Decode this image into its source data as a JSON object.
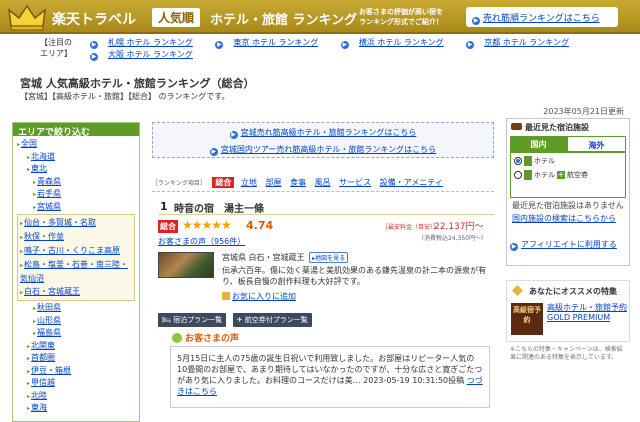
{
  "banner": {
    "title_part1": "楽天トラベル",
    "title_pill": "人気順",
    "title_part2": "ホテル・旅館 ランキング",
    "sub_line1": "お客さまの評価が高い宿を",
    "sub_line2": "ランキング形式でご紹介！",
    "sales_link": "売れ筋順ランキングはこちら"
  },
  "areas": {
    "label": "【注目のエリア】",
    "links": [
      "札幌 ホテル ランキング",
      "東京 ホテル ランキング",
      "横浜 ホテル ランキング",
      "京都 ホテル ランキング",
      "大阪 ホテル ランキング"
    ]
  },
  "page": {
    "title": "宮城 人気高級ホテル・旅館ランキング（総合）",
    "desc": "【宮城】【高級ホテル・旅館】【総合】 のランキングです。",
    "date": "2023年05月21日更新"
  },
  "sidebar": {
    "heading": "エリアで絞り込む",
    "items": [
      "全国",
      "北海道",
      "東北",
      "青森県",
      "岩手県",
      "宮城県"
    ],
    "miyagi_sub": [
      "仙台・多賀城・名取",
      "秋保・作並",
      "鳴子・古川・くりこま高原",
      "松島・塩釜・石巻・南三陸・気仙沼",
      "白石・宮城蔵王"
    ],
    "after": [
      "秋田県",
      "山形県",
      "福島県",
      "北関東",
      "首都圏",
      "伊豆・箱根",
      "甲信越",
      "北陸",
      "東海"
    ]
  },
  "notice": {
    "line1": "宮城売れ筋高級ホテル・旅館ランキングはこちら",
    "line2": "宮城国内ツアー売れ筋高級ホテル・旅館ランキングはこちら"
  },
  "tabs": {
    "label": "［ランキング項目］",
    "selected": "総合",
    "items": [
      "立地",
      "部屋",
      "食事",
      "風呂",
      "サービス",
      "設備・アメニティ"
    ]
  },
  "hotel": {
    "rank": "1",
    "name": "時音の宿　湯主一條",
    "total_tag": "総合",
    "stars": "★★★★★",
    "score": "4.74",
    "price_label": "［最安料金（目安）］",
    "price": "22,137円〜",
    "price_sub": "（消費税込24,350円〜）",
    "reviews": "お客さまの声（956件）",
    "location": "宮城県 白石・宮城蔵王",
    "map_label": "地図を見る",
    "description": "伝承六百年。傷に効く薬湯と美肌効果のある鎌先温泉の計二本の源泉が有り、板長自慢の創作料理も大好評です。",
    "fav": "お気に入りに追加",
    "plan_buttons": [
      "宿泊プラン一覧",
      "航空券付プラン一覧"
    ],
    "voice_heading": "お客さまの声",
    "voice_text": "5月15日に主人の75歳の誕生日祝いで利用致しました。お部屋はリピーター人気の10畳間のお部屋で、あまり期待してはいなかったのですが、十分な広さと寛ぎごたつがあり気に入りました。お料理のコースだけは美…",
    "voice_date": "2023-05-19 10:31:50投稿",
    "voice_more": "つづきはこちら"
  },
  "recent": {
    "heading": "最近見た宿泊施設",
    "tab_on": "国内",
    "tab_off": "海外",
    "radio1": "ホテル",
    "radio2a": "ホテル",
    "radio2b": "航空券",
    "plus": "+",
    "text": "最近見た宿泊施設はありません",
    "search_link": "国内施設の検索はこちらから",
    "affiliate": "アフィリエイトに利用する"
  },
  "osusume": {
    "heading": "あなたにオススメの特集",
    "img_text": "高級宿予約",
    "link": "高級ホテル・旅館予約 GOLD PREMIUM",
    "note": "※こちらの特集・キャンペーンは、検索結果に関連のある特集を表示しています。"
  },
  "colors": {
    "banner_gold": "#b8981f",
    "sidebar_green": "#5e9c27",
    "accent_red": "#dd2222",
    "link_blue": "#0044cc"
  }
}
